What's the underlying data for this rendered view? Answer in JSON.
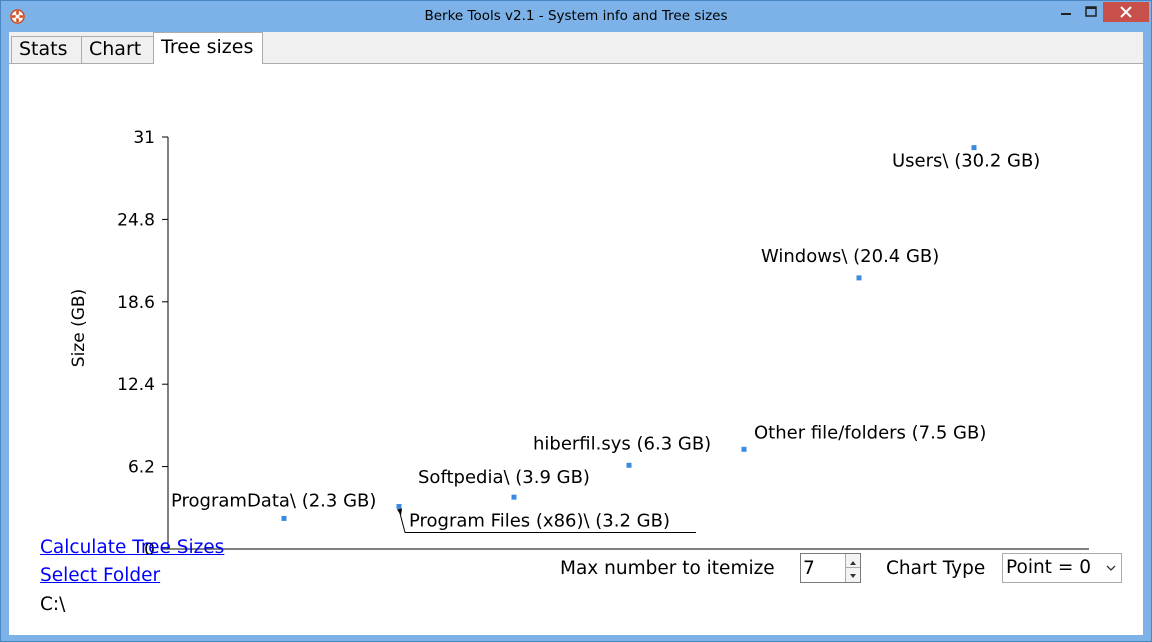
{
  "window": {
    "title": "Berke Tools v2.1 - System info and Tree sizes",
    "accent_color": "#7cb2e8",
    "close_color": "#c7504b"
  },
  "tabs": [
    {
      "label": "Stats",
      "active": false
    },
    {
      "label": "Chart",
      "active": false
    },
    {
      "label": "Tree sizes",
      "active": true
    }
  ],
  "chart_data": {
    "type": "scatter",
    "ylabel": "Size (GB)",
    "xlabel": "",
    "ylim": [
      0,
      31
    ],
    "yticks": [
      "0",
      "6.2",
      "12.4",
      "18.6",
      "24.8",
      "31"
    ],
    "point_color": "#3c8ae0",
    "points": [
      {
        "x": 1,
        "y": 2.3,
        "label": "ProgramData\\ (2.3 GB)"
      },
      {
        "x": 2,
        "y": 3.2,
        "label": "Program Files (x86)\\ (3.2 GB)"
      },
      {
        "x": 3,
        "y": 3.9,
        "label": "Softpedia\\ (3.9 GB)"
      },
      {
        "x": 4,
        "y": 6.3,
        "label": "hiberfil.sys (6.3 GB)"
      },
      {
        "x": 5,
        "y": 7.5,
        "label": "Other file/folders (7.5 GB)"
      },
      {
        "x": 6,
        "y": 20.4,
        "label": "Windows\\ (20.4 GB)"
      },
      {
        "x": 7,
        "y": 30.2,
        "label": "Users\\ (30.2 GB)"
      }
    ]
  },
  "links": {
    "calculate": "Calculate Tree Sizes",
    "select_folder": "Select Folder"
  },
  "current_path": "C:\\",
  "controls": {
    "max_label": "Max number to itemize",
    "max_value": "7",
    "chart_type_label": "Chart Type",
    "chart_type_value": "Point = 0"
  }
}
